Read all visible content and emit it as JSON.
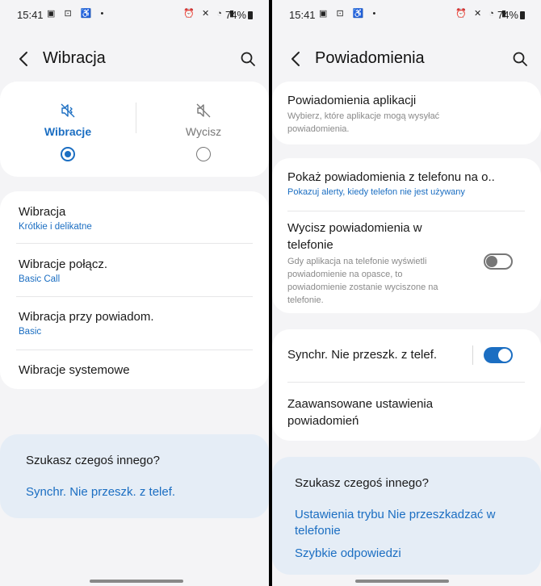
{
  "status_bar": {
    "time": "15:41",
    "battery": "74%",
    "left_icons": [
      "gallery-icon",
      "screenshot-icon",
      "accessibility-icon",
      "dot"
    ],
    "right_icons": [
      "alarm-icon",
      "mute-icon",
      "wifi-icon",
      "signal-icon"
    ]
  },
  "left": {
    "title": "Wibracja",
    "modes": [
      {
        "label": "Wibracje",
        "selected": true
      },
      {
        "label": "Wycisz",
        "selected": false
      }
    ],
    "items": [
      {
        "title": "Wibracja",
        "subtitle": "Krótkie i delikatne"
      },
      {
        "title": "Wibracje połącz.",
        "subtitle": "Basic Call"
      },
      {
        "title": "Wibracja przy powiadom.",
        "subtitle": "Basic"
      },
      {
        "title": "Wibracje systemowe",
        "subtitle": ""
      }
    ],
    "suggest": {
      "title": "Szukasz czegoś innego?",
      "links": [
        "Synchr. Nie przeszk. z telef."
      ]
    }
  },
  "right": {
    "title": "Powiadomienia",
    "app_notifications": {
      "title": "Powiadomienia aplikacji",
      "desc": "Wybierz, które aplikacje mogą wysyłać powiadomienia."
    },
    "show_from_phone": {
      "title": "Pokaż powiadomienia z telefonu na o..",
      "subtitle": "Pokazuj alerty, kiedy telefon nie jest używany"
    },
    "mute_on_phone": {
      "title": "Wycisz powiadomienia w telefonie",
      "desc": "Gdy aplikacja na telefonie wyświetli powiadomienie na opasce, to powiadomienie zostanie wyciszone na telefonie.",
      "enabled": false
    },
    "sync_dnd": {
      "title": "Synchr. Nie przeszk. z telef.",
      "enabled": true
    },
    "advanced": {
      "title": "Zaawansowane ustawienia powiadomień"
    },
    "suggest": {
      "title": "Szukasz czegoś innego?",
      "links": [
        "Ustawienia trybu Nie przeszkadzać w telefonie",
        "Szybkie odpowiedzi"
      ]
    }
  },
  "colors": {
    "accent": "#1b6ec2",
    "background": "#f4f4f6",
    "card": "#ffffff",
    "suggest_card": "#e5edf6"
  }
}
